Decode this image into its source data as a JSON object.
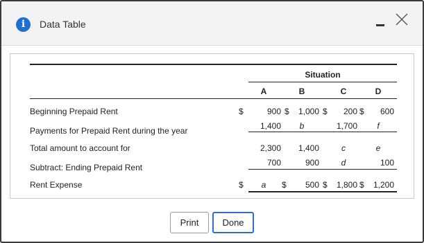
{
  "window": {
    "title": "Data Table",
    "info_icon_glyph": "i",
    "accent_color": "#1f6fd1"
  },
  "table": {
    "group_header": "Situation",
    "columns": [
      "A",
      "B",
      "C",
      "D"
    ],
    "rows": [
      {
        "label": "Beginning Prepaid Rent",
        "dollar": "$",
        "values": [
          "900",
          "1,000",
          "200",
          "600"
        ],
        "value_dollars": [
          "$",
          "$",
          "$",
          ""
        ]
      },
      {
        "label": "Payments for Prepaid Rent during the year",
        "dollar": "",
        "values": [
          "1,400",
          "b",
          "1,700",
          "f"
        ],
        "value_dollars": [
          "",
          "",
          "",
          ""
        ]
      },
      {
        "label": "Total amount to account for",
        "dollar": "",
        "values": [
          "2,300",
          "1,400",
          "c",
          "e"
        ],
        "value_dollars": [
          "",
          "",
          "",
          ""
        ]
      },
      {
        "label": "Subtract: Ending Prepaid Rent",
        "dollar": "",
        "values": [
          "700",
          "900",
          "d",
          "100"
        ],
        "value_dollars": [
          "",
          "",
          "",
          ""
        ]
      },
      {
        "label": "Rent Expense",
        "dollar": "$",
        "values": [
          "a",
          "500",
          "1,800",
          "1,200"
        ],
        "value_dollars": [
          "$",
          "$",
          "$",
          ""
        ]
      }
    ]
  },
  "buttons": {
    "print_label": "Print",
    "done_label": "Done"
  }
}
